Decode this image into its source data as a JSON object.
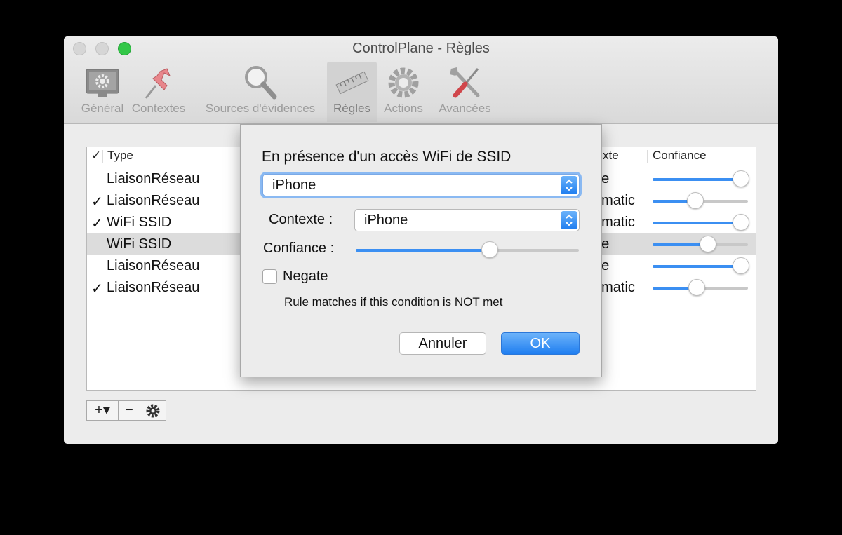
{
  "window": {
    "title": "ControlPlane - Règles"
  },
  "toolbar": {
    "items": [
      {
        "label": "Général",
        "icon": "display-gear-icon"
      },
      {
        "label": "Contextes",
        "icon": "pushpin-icon"
      },
      {
        "label": "Sources d'évidences",
        "icon": "magnifier-icon"
      },
      {
        "label": "Règles",
        "icon": "ruler-icon",
        "selected": true
      },
      {
        "label": "Actions",
        "icon": "gear-icon"
      },
      {
        "label": "Avancées",
        "icon": "tools-icon"
      }
    ]
  },
  "table": {
    "headers": {
      "check": "✓",
      "type": "Type",
      "context": "xte",
      "confidence": "Confiance"
    },
    "rows": [
      {
        "checked": "",
        "type": "LiaisonRéseau",
        "context": "ne",
        "confidence": 0.93
      },
      {
        "checked": "✓",
        "type": "LiaisonRéseau",
        "context": "omatic",
        "confidence": 0.45
      },
      {
        "checked": "✓",
        "type": "WiFi SSID",
        "context": "omatic",
        "confidence": 0.93
      },
      {
        "checked": "",
        "type": "WiFi SSID",
        "context": "ne",
        "confidence": 0.58,
        "selected": true
      },
      {
        "checked": "",
        "type": "LiaisonRéseau",
        "context": "ne",
        "confidence": 0.93
      },
      {
        "checked": "✓",
        "type": "LiaisonRéseau",
        "context": "omatic",
        "confidence": 0.46
      }
    ]
  },
  "bottom_buttons": {
    "add": "+▾",
    "remove": "−",
    "gear_icon": "gear-icon"
  },
  "sheet": {
    "title": "En présence d'un accès WiFi de SSID",
    "ssid_value": "iPhone",
    "context_label": "Contexte :",
    "context_value": "iPhone",
    "confidence_label": "Confiance :",
    "confidence_value": 0.6,
    "negate_label": "Negate",
    "negate_checked": false,
    "negate_note": "Rule matches if this condition is NOT met",
    "cancel_label": "Annuler",
    "ok_label": "OK"
  },
  "colors": {
    "accent": "#3b8ff2",
    "zoom_button": "#33c748"
  }
}
